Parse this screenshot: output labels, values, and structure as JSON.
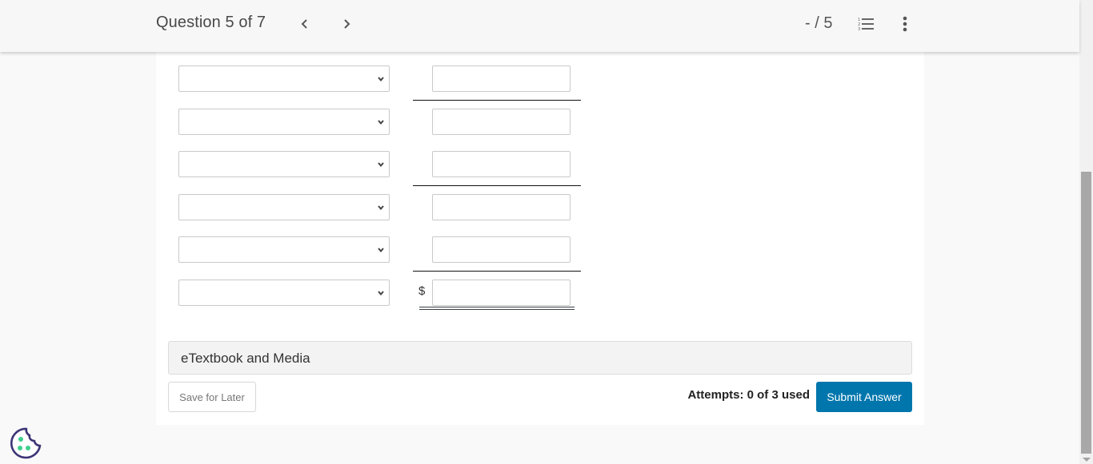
{
  "header": {
    "question_label": "Question 5 of 7",
    "prev_icon": "chevron-left-icon",
    "next_icon": "chevron-right-icon",
    "score": "- / 5",
    "list_icon": "numbered-list-icon",
    "more_icon": "more-vertical-icon"
  },
  "form": {
    "rows": [
      {
        "select_value": "",
        "input_value": "",
        "line_after": "single"
      },
      {
        "select_value": "",
        "input_value": "",
        "line_after": "none"
      },
      {
        "select_value": "",
        "input_value": "",
        "line_after": "single"
      },
      {
        "select_value": "",
        "input_value": "",
        "line_after": "none"
      },
      {
        "select_value": "",
        "input_value": "",
        "line_after": "single"
      },
      {
        "select_value": "",
        "input_value": "",
        "prefix": "$",
        "line_after": "double"
      }
    ]
  },
  "footer": {
    "etextbook_label": "eTextbook and Media",
    "save_label": "Save for Later",
    "attempts_text": "Attempts: 0 of 3 used",
    "submit_label": "Submit Answer",
    "submit_color": "#0076ad"
  },
  "cookie": {
    "icon": "cookie-icon"
  }
}
